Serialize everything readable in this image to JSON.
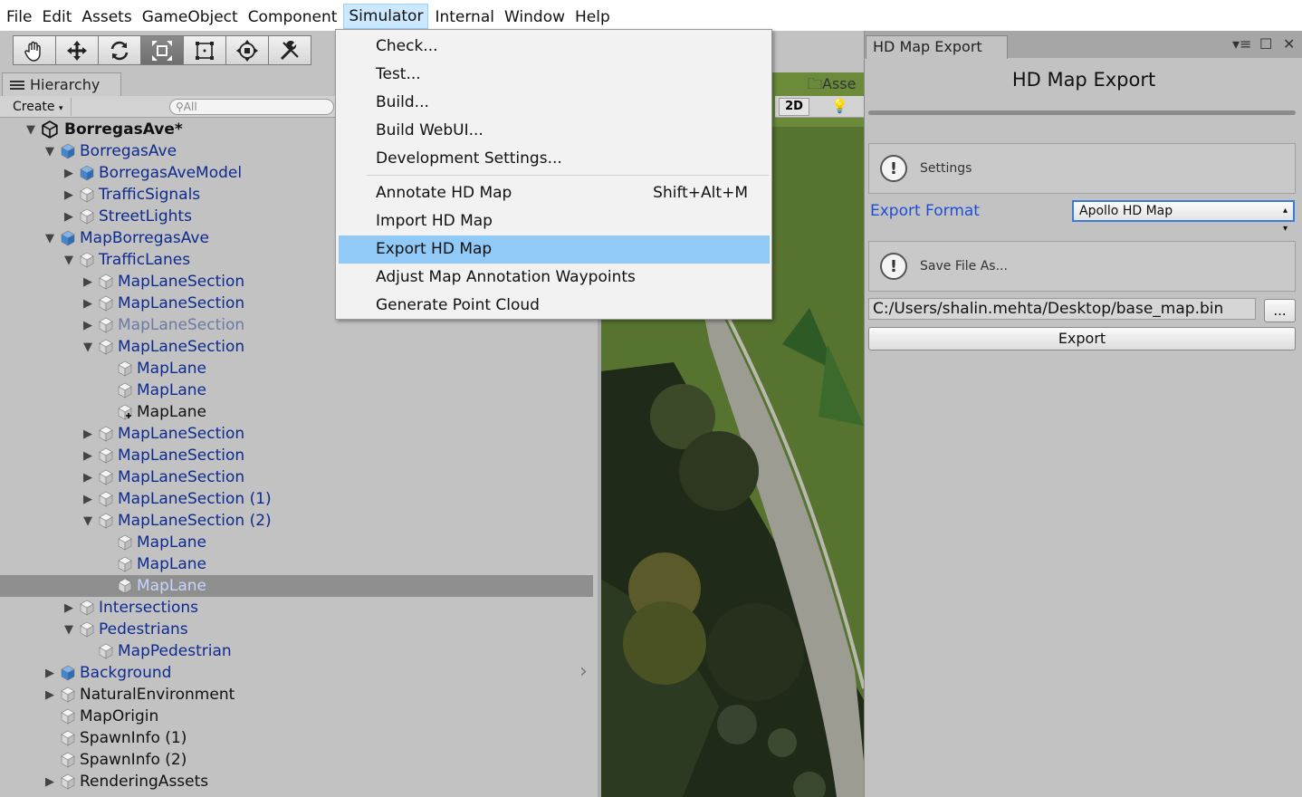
{
  "menubar": {
    "items": [
      "File",
      "Edit",
      "Assets",
      "GameObject",
      "Component",
      "Simulator",
      "Internal",
      "Window",
      "Help"
    ],
    "active": "Simulator"
  },
  "toolbar": {
    "tools": [
      "hand-tool-icon",
      "move-tool-icon",
      "rotate-tool-icon",
      "scale-tool-icon",
      "rect-tool-icon",
      "transform-tool-icon",
      "custom-tool-icon"
    ]
  },
  "hierarchy": {
    "tab_label": "Hierarchy",
    "create_label": "Create",
    "search_placeholder": "All",
    "rows": [
      {
        "label": "BorregasAve*",
        "depth": 0,
        "arrow": "down",
        "icon": "unity",
        "color": "black",
        "bold": true
      },
      {
        "label": "BorregasAve",
        "depth": 1,
        "arrow": "down",
        "icon": "blue",
        "color": "blue"
      },
      {
        "label": "BorregasAveModel",
        "depth": 2,
        "arrow": "right",
        "icon": "blue",
        "color": "blue"
      },
      {
        "label": "TrafficSignals",
        "depth": 2,
        "arrow": "right",
        "icon": "white",
        "color": "blue"
      },
      {
        "label": "StreetLights",
        "depth": 2,
        "arrow": "right",
        "icon": "white",
        "color": "blue"
      },
      {
        "label": "MapBorregasAve",
        "depth": 1,
        "arrow": "down",
        "icon": "blue",
        "color": "blue"
      },
      {
        "label": "TrafficLanes",
        "depth": 2,
        "arrow": "down",
        "icon": "white",
        "color": "blue"
      },
      {
        "label": "MapLaneSection",
        "depth": 3,
        "arrow": "right",
        "icon": "white",
        "color": "blue"
      },
      {
        "label": "MapLaneSection",
        "depth": 3,
        "arrow": "right",
        "icon": "white",
        "color": "blue"
      },
      {
        "label": "MapLaneSection",
        "depth": 3,
        "arrow": "right",
        "icon": "white",
        "color": "gray"
      },
      {
        "label": "MapLaneSection",
        "depth": 3,
        "arrow": "down",
        "icon": "white",
        "color": "blue"
      },
      {
        "label": "MapLane",
        "depth": 4,
        "arrow": "none",
        "icon": "white",
        "color": "blue"
      },
      {
        "label": "MapLane",
        "depth": 4,
        "arrow": "none",
        "icon": "white",
        "color": "blue"
      },
      {
        "label": "MapLane",
        "depth": 4,
        "arrow": "none",
        "icon": "white-plus",
        "color": "black"
      },
      {
        "label": "MapLaneSection",
        "depth": 3,
        "arrow": "right",
        "icon": "white",
        "color": "blue"
      },
      {
        "label": "MapLaneSection",
        "depth": 3,
        "arrow": "right",
        "icon": "white",
        "color": "blue"
      },
      {
        "label": "MapLaneSection",
        "depth": 3,
        "arrow": "right",
        "icon": "white",
        "color": "blue"
      },
      {
        "label": "MapLaneSection (1)",
        "depth": 3,
        "arrow": "right",
        "icon": "white",
        "color": "blue"
      },
      {
        "label": "MapLaneSection (2)",
        "depth": 3,
        "arrow": "down",
        "icon": "white",
        "color": "blue"
      },
      {
        "label": "MapLane",
        "depth": 4,
        "arrow": "none",
        "icon": "white",
        "color": "blue"
      },
      {
        "label": "MapLane",
        "depth": 4,
        "arrow": "none",
        "icon": "white",
        "color": "blue"
      },
      {
        "label": "MapLane",
        "depth": 4,
        "arrow": "none",
        "icon": "white",
        "color": "light",
        "selected": true
      },
      {
        "label": "Intersections",
        "depth": 2,
        "arrow": "right",
        "icon": "white",
        "color": "blue"
      },
      {
        "label": "Pedestrians",
        "depth": 2,
        "arrow": "down",
        "icon": "white",
        "color": "blue"
      },
      {
        "label": "MapPedestrian",
        "depth": 3,
        "arrow": "none",
        "icon": "white",
        "color": "blue"
      },
      {
        "label": "Background",
        "depth": 1,
        "arrow": "right",
        "icon": "blue",
        "color": "blue"
      },
      {
        "label": "NaturalEnvironment",
        "depth": 1,
        "arrow": "right",
        "icon": "white",
        "color": "black"
      },
      {
        "label": "MapOrigin",
        "depth": 1,
        "arrow": "none",
        "icon": "white",
        "color": "black"
      },
      {
        "label": "SpawnInfo (1)",
        "depth": 1,
        "arrow": "none",
        "icon": "white",
        "color": "black"
      },
      {
        "label": "SpawnInfo (2)",
        "depth": 1,
        "arrow": "none",
        "icon": "white",
        "color": "black"
      },
      {
        "label": "RenderingAssets",
        "depth": 1,
        "arrow": "right",
        "icon": "white",
        "color": "black"
      }
    ]
  },
  "scene": {
    "btn_2d": "2D",
    "asset_tab": "Asse"
  },
  "simulator_menu": {
    "items": [
      {
        "label": "Check...",
        "shortcut": ""
      },
      {
        "label": "Test...",
        "shortcut": ""
      },
      {
        "label": "Build...",
        "shortcut": ""
      },
      {
        "label": "Build WebUI...",
        "shortcut": ""
      },
      {
        "label": "Development Settings...",
        "shortcut": ""
      },
      {
        "label": "Annotate HD Map",
        "shortcut": "Shift+Alt+M"
      },
      {
        "label": "Import HD Map",
        "shortcut": ""
      },
      {
        "label": "Export HD Map",
        "shortcut": "",
        "highlighted": true
      },
      {
        "label": "Adjust Map Annotation Waypoints",
        "shortcut": ""
      },
      {
        "label": "Generate Point Cloud",
        "shortcut": ""
      }
    ]
  },
  "export_window": {
    "tab_title": "HD Map Export",
    "heading": "HD Map Export",
    "settings_help": "Settings",
    "format_label": "Export Format",
    "format_value": "Apollo HD Map",
    "save_help": "Save File As...",
    "path_value": "C:/Users/shalin.mehta/Desktop/base_map.bin",
    "browse_label": "...",
    "export_label": "Export"
  },
  "colors": {
    "menu_highlight": "#91c9f7",
    "link_blue": "#1d4fd6",
    "hierarchy_blue": "#0d2b8f",
    "selected_row": "#8f8f8f"
  }
}
